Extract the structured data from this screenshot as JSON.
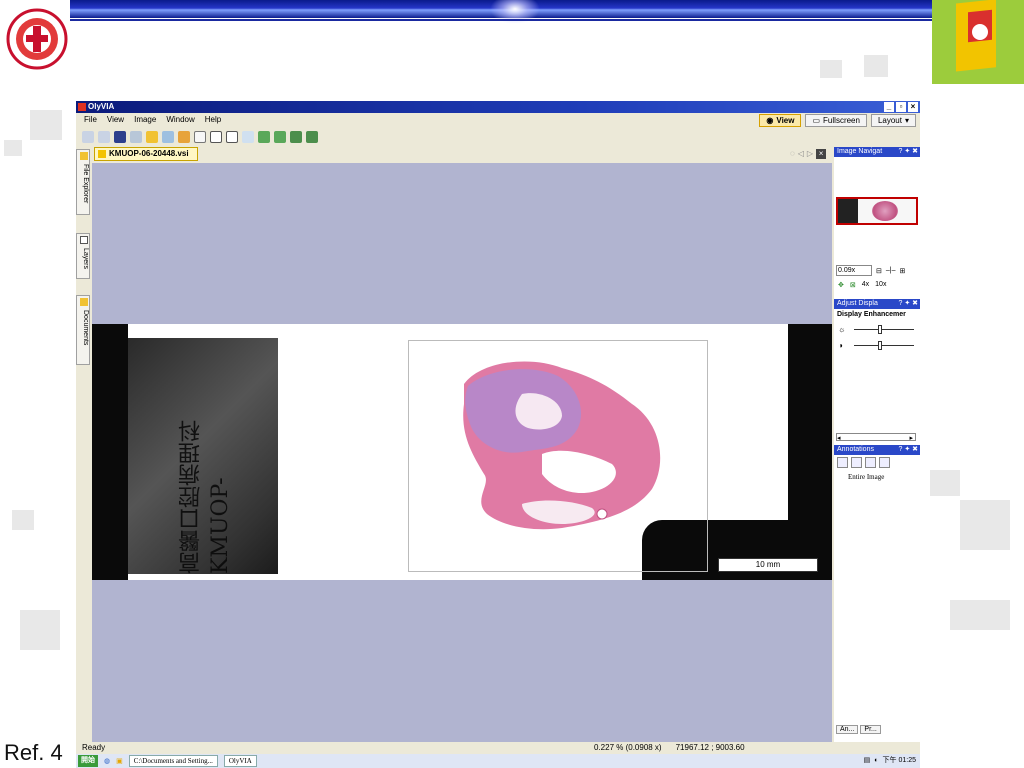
{
  "slide": {
    "ref_label": "Ref. 4"
  },
  "app": {
    "title": "OlyVIA",
    "menu": [
      "File",
      "View",
      "Image",
      "Window",
      "Help"
    ],
    "view_tab": "View",
    "fullscreen_tab": "Fullscreen",
    "layout_button": "Layout",
    "document_tab": "KMUOP-06-20448.vsi",
    "sidebar_tabs": [
      "File Explorer",
      "Layers",
      "Documents"
    ]
  },
  "slide_image": {
    "label_handwriting": "高醫口腔病理科 KMUOP-",
    "scale_bar": "10 mm"
  },
  "right_panel": {
    "image_navigator_title": "Image Navigat",
    "zoom_value": "0.09x",
    "magnifications": [
      "4x",
      "10x"
    ],
    "adjust_display_title": "Adjust Displa",
    "display_enhancement": "Display Enhancemer",
    "annotations_title": "Annotations",
    "annotation_item": "Entire Image",
    "bottom_tabs": [
      "An...",
      "Pr..."
    ]
  },
  "status": {
    "ready": "Ready",
    "zoom_percent": "0.227 % (0.0908 x)",
    "coordinates": "71967.12  ;  9003.60"
  },
  "taskbar": {
    "start": "開始",
    "tasks": [
      "C:\\Documents and Setting...",
      "OlyVIA"
    ],
    "clock": "下午 01:25"
  },
  "colors": {
    "viewport_bg": "#b1b4d0",
    "title_blue": "#2a48c8",
    "tissue_pink": "#e06a9c"
  }
}
